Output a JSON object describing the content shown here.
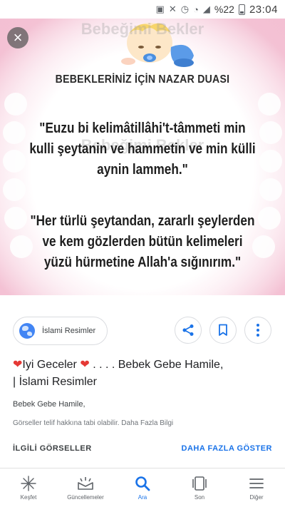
{
  "status_bar": {
    "battery_text": "%22",
    "time": "23:04"
  },
  "image": {
    "watermark": "Bebeğimi Bekler",
    "title": "BEBEKLERİNİZ İÇİN NAZAR DUASI",
    "prayer_1": "\"Euzu bi kelimâtillâhi't-tâmmeti min kulli şeytanin ve hammetin ve min külli aynin lammeh.\"",
    "prayer_2": "\"Her türlü şeytandan, zararlı şeylerden ve kem gözlerden bütün kelimeleri yüzü hürmetine Allah'a sığınırım.\"",
    "close_icon": "close-icon"
  },
  "source": {
    "chip_label": "İslami Resimler",
    "icons": [
      "globe-icon",
      "share-icon",
      "bookmark-icon",
      "more-vert-icon"
    ]
  },
  "result": {
    "title_part1": "Iyi Geceler",
    "title_part2": ". . . . Bebek Gebe Hamile,",
    "title_line2": "| İslami Resimler",
    "site": "Bebek Gebe Hamile,",
    "note": "Görseller telif hakkına tabi olabilir. Daha Fazla Bilgi"
  },
  "related": {
    "label": "İLGİLİ GÖRSELLER",
    "show_more": "DAHA FAZLA GÖSTER"
  },
  "bottom_nav": {
    "items": [
      {
        "label": "Keşfet",
        "icon": "asterisk-icon"
      },
      {
        "label": "Güncellemeler",
        "icon": "updates-icon"
      },
      {
        "label": "Ara",
        "icon": "search-icon"
      },
      {
        "label": "Son",
        "icon": "recent-tabs-icon"
      },
      {
        "label": "Diğer",
        "icon": "menu-icon"
      }
    ],
    "active_index": 2
  },
  "colors": {
    "accent": "#1a73e8",
    "heart": "#e53935",
    "frame_pink": "#f6c9da"
  }
}
